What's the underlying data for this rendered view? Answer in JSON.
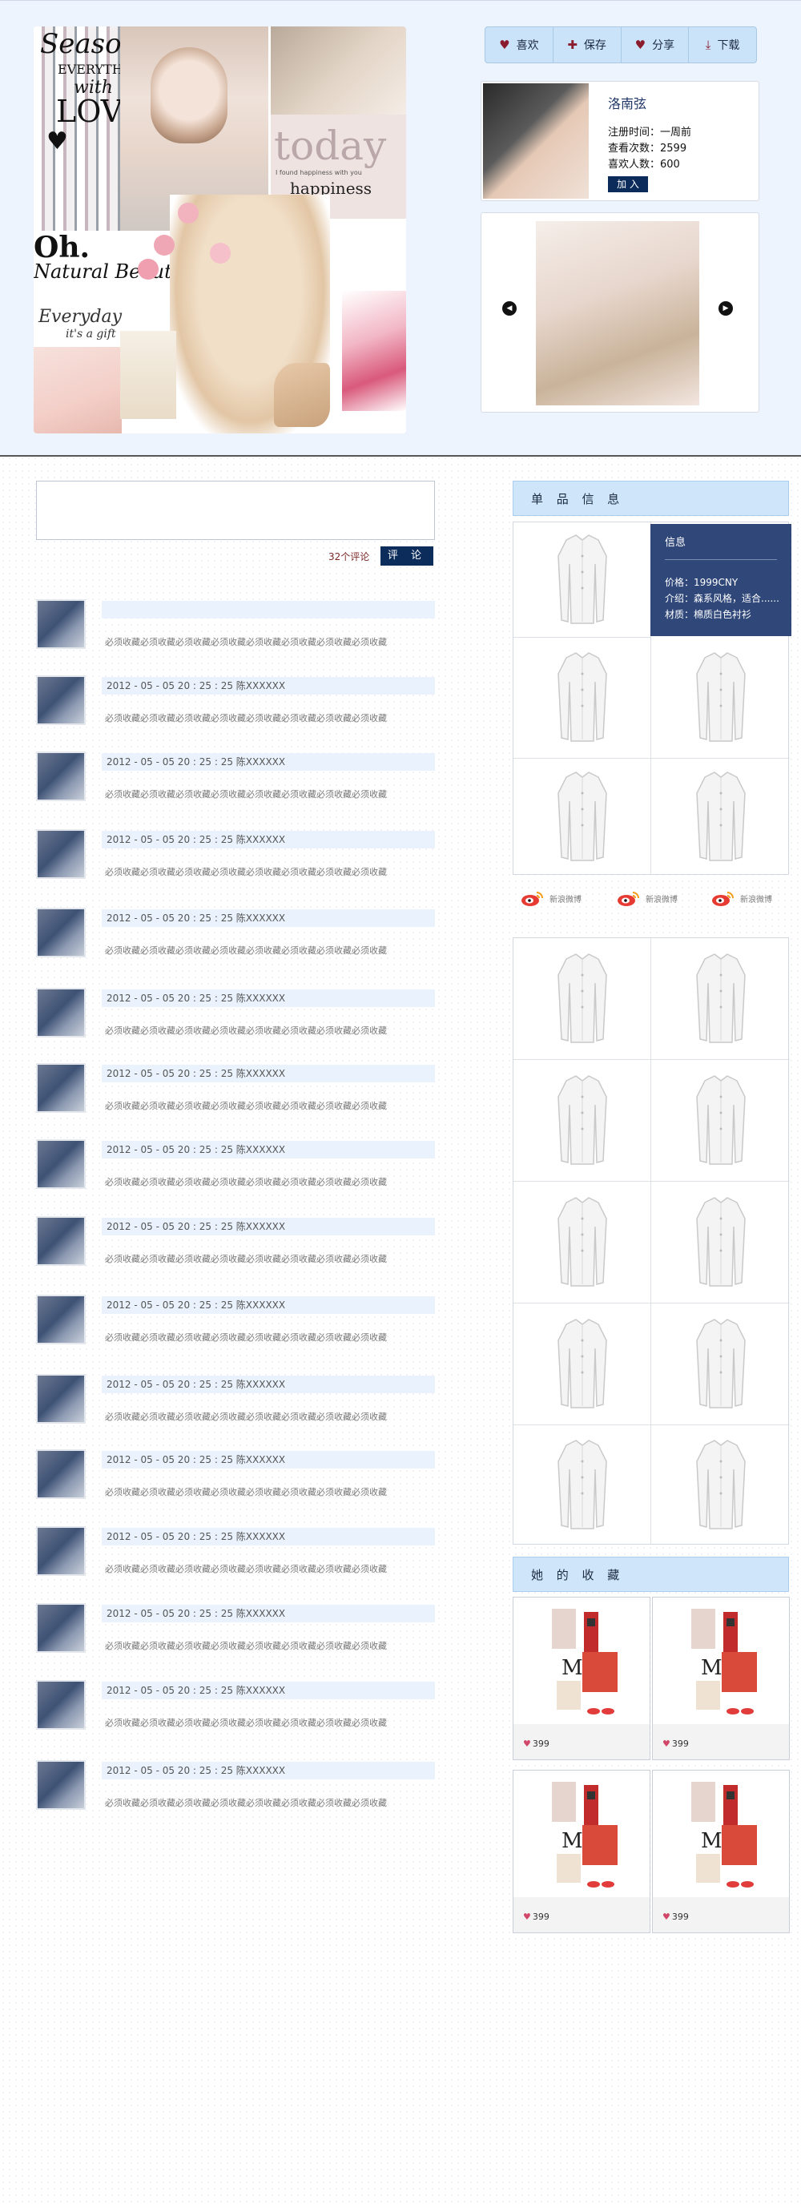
{
  "actions": {
    "like": "喜欢",
    "save": "保存",
    "share": "分享",
    "download": "下载"
  },
  "collage_text": {
    "season": "Season",
    "everything": "EVERYTHING",
    "with": "with",
    "love": "LOVE",
    "oh": "Oh.",
    "natural_beauty": "Natural Beauty",
    "everyday": "Everyday",
    "gift": "it's a gift",
    "today": "today",
    "happiness": "happiness",
    "found": "I found happiness with you"
  },
  "profile": {
    "name": "洛南弦",
    "register": "注册时间：一周前",
    "views": "查看次数：2599",
    "likes": "喜欢人数：600",
    "join": "加 入"
  },
  "comments": {
    "count": "32个评论",
    "submit": "评 论",
    "body": "必须收藏必须收藏必须收藏必须收藏必须收藏必须收藏必须收藏必须收藏",
    "first_head": "",
    "meta": "2012 - 05 - 05  20 : 25 : 25    陈XXXXXX"
  },
  "product": {
    "section_title": "单 品 信 息",
    "info_title": "信息",
    "price": "价格：1999CNY",
    "intro": "介绍：森系风格，适合......",
    "material": "材质：棉质白色衬衫"
  },
  "weibo": [
    "新浪微博",
    "新浪微博",
    "新浪微博"
  ],
  "favorites": {
    "section_title": "她 的 收 藏",
    "items": [
      {
        "likes": "399"
      },
      {
        "likes": "399"
      },
      {
        "likes": "399"
      },
      {
        "likes": "399"
      }
    ]
  }
}
